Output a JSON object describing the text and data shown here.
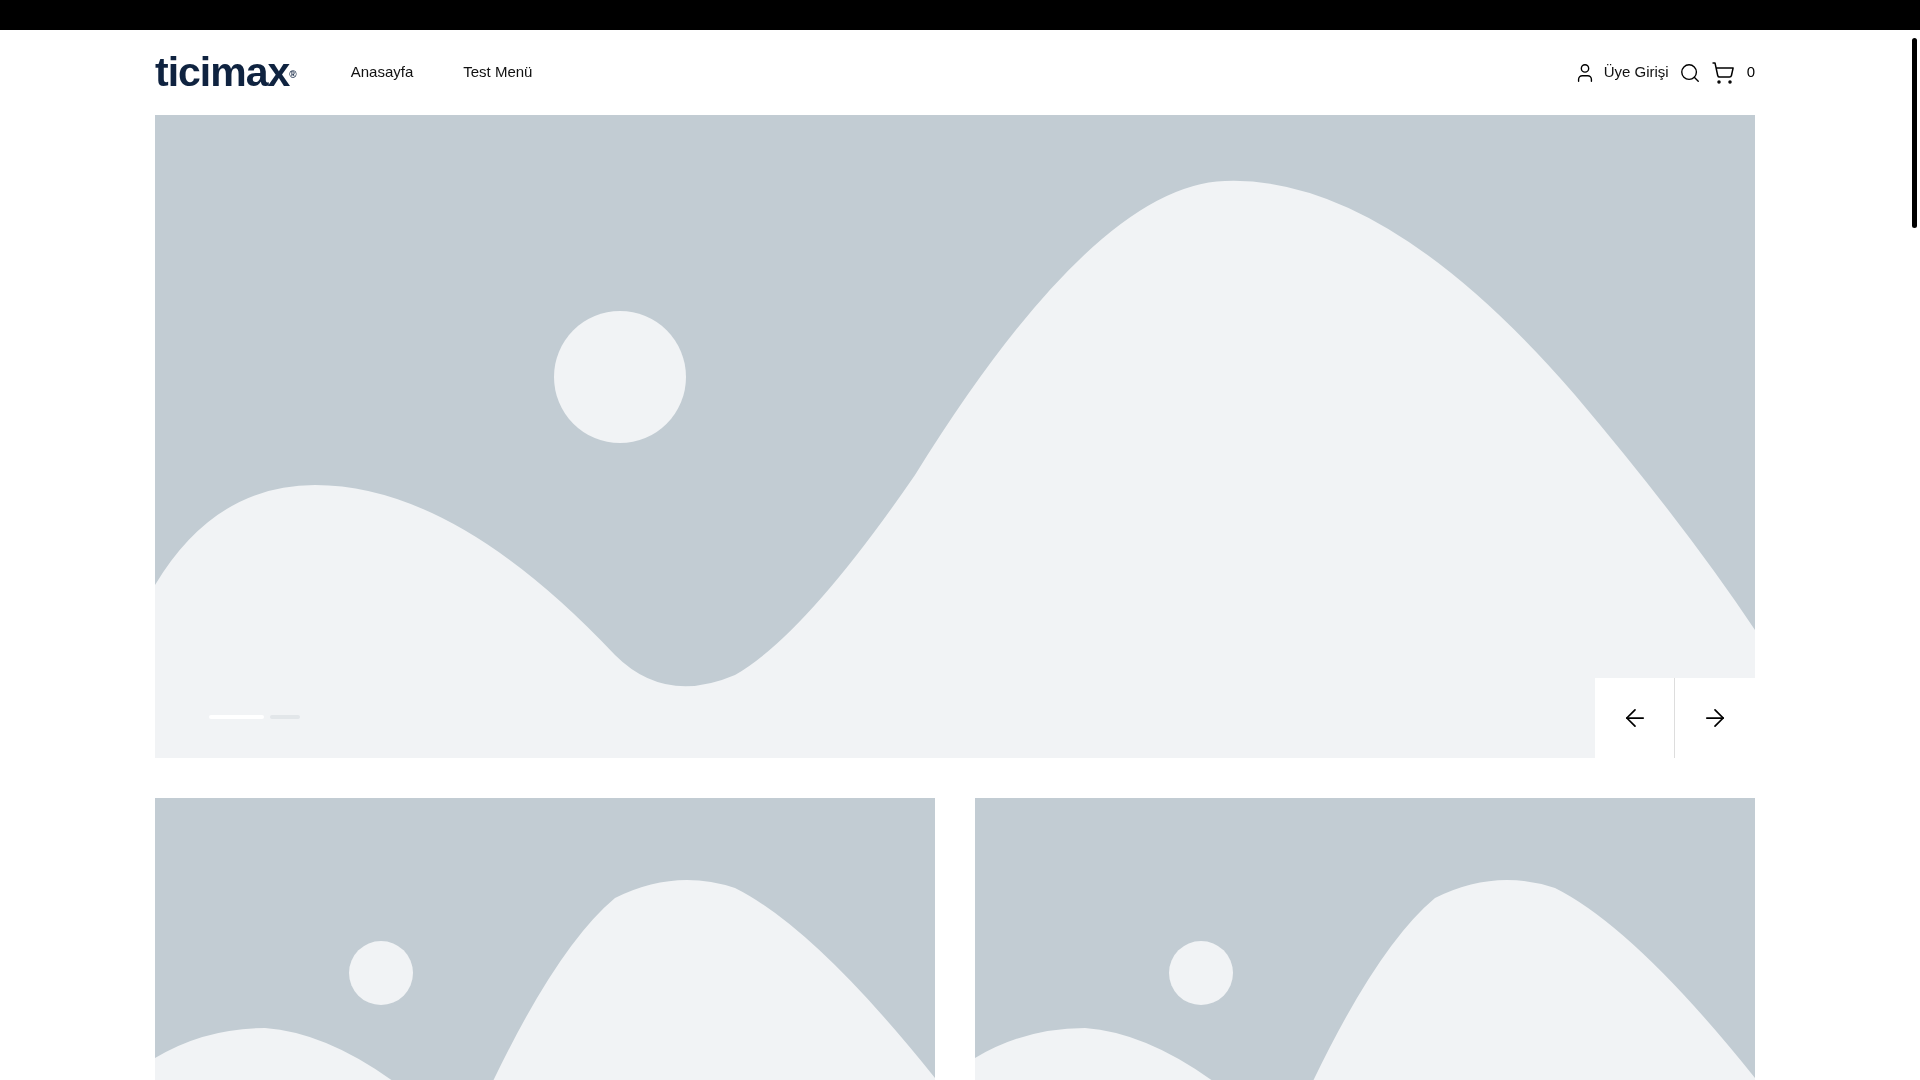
{
  "header": {
    "logo": "ticimax",
    "logo_mark": "®",
    "nav": [
      {
        "label": "Anasayfa"
      },
      {
        "label": "Test Menü"
      }
    ],
    "account": "Üye Girişi",
    "cart_count": "0"
  },
  "slider": {
    "dots": [
      {
        "selected": true
      },
      {
        "selected": false
      }
    ]
  }
}
